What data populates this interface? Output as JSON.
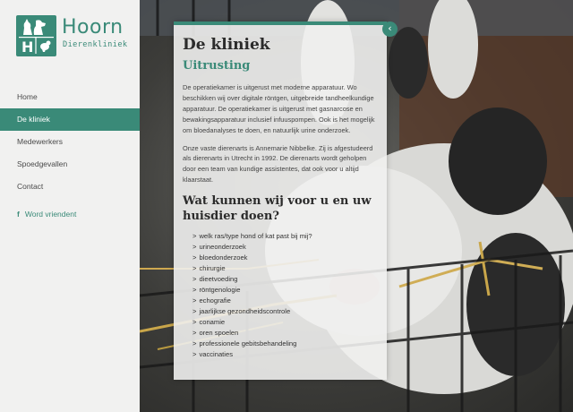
{
  "brand": {
    "name": "Hoorn",
    "subtitle": "Dierenkliniek",
    "logo_letter": "H",
    "color": "#3a8a78"
  },
  "nav": {
    "items": [
      {
        "label": "Home",
        "active": false
      },
      {
        "label": "De kliniek",
        "active": true
      },
      {
        "label": "Medewerkers",
        "active": false
      },
      {
        "label": "Spoedgevallen",
        "active": false
      },
      {
        "label": "Contact",
        "active": false
      }
    ],
    "social": {
      "icon": "f",
      "label": "Word vriendent"
    }
  },
  "panel": {
    "collapse_icon": "‹",
    "title": "De kliniek",
    "subtitle": "Uitrusting",
    "paragraph1": "De operatiekamer is uitgerust met moderne apparatuur. Wo beschikken wij over digitale röntgen, uitgebreide tandheelkundige apparatuur. De operatiekamer is uitgerust met gasnarcose en bewakingsapparatuur inclusief infuuspompen. Ook is het mogelijk om bloedanalyses te doen, en natuurlijk urine onderzoek.",
    "paragraph2": "Onze vaste dierenarts is Annemarie Nibbelke. Zij is afgestudeerd als dierenarts in Utrecht in 1992. De dierenarts wordt geholpen door een team van kundige assistentes, dat ook voor u altijd klaarstaat.",
    "heading2": "Wat kunnen wij voor u en uw huisdier doen?",
    "services": [
      "welk ras/type hond of kat past bij mij?",
      "urineonderzoek",
      "bloedonderzoek",
      "chirurgie",
      "dieetvoeding",
      "röntgenologie",
      "echografie",
      "jaarlijkse gezondheidscontrole",
      "conamie",
      "oren spoelen",
      "professionele gebitsbehandeling",
      "vaccinaties"
    ],
    "service_prefix": ">"
  }
}
